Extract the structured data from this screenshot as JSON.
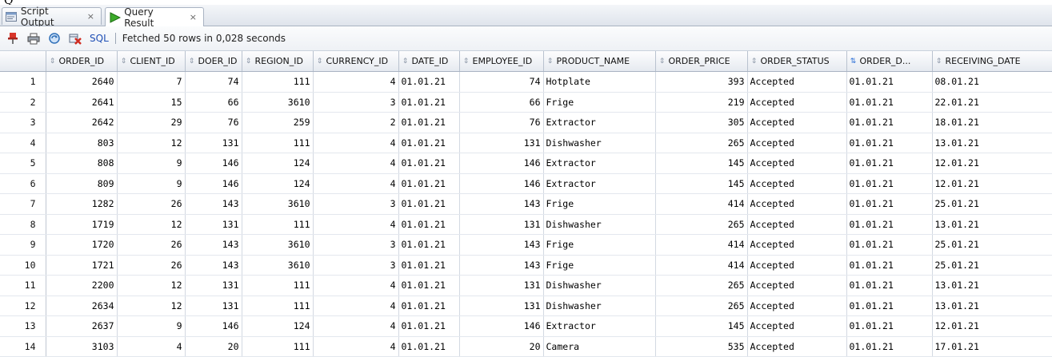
{
  "tabs": [
    {
      "label": "Script Output",
      "close": "×",
      "icon": "script-output-icon"
    },
    {
      "label": "Query Result",
      "close": "×",
      "icon": "run-arrow-icon"
    }
  ],
  "toolbar": {
    "sql_label": "SQL",
    "status": "Fetched 50 rows in 0,028 seconds",
    "icons": [
      "pin-icon",
      "print-icon",
      "refresh-icon",
      "delete-icon"
    ]
  },
  "colors": {
    "accent": "#2b6fd6",
    "link": "#1f4fb5",
    "header_bg": "#e6eaf0"
  },
  "grid": {
    "columns": [
      "ORDER_ID",
      "CLIENT_ID",
      "DOER_ID",
      "REGION_ID",
      "CURRENCY_ID",
      "DATE_ID",
      "EMPLOYEE_ID",
      "PRODUCT_NAME",
      "ORDER_PRICE",
      "ORDER_STATUS",
      "ORDER_D...",
      "RECEIVING_DATE"
    ],
    "rows": [
      [
        "1",
        "2640",
        "7",
        "74",
        "111",
        "4",
        "01.01.21",
        "74",
        "Hotplate",
        "393",
        "Accepted",
        "01.01.21",
        "08.01.21"
      ],
      [
        "2",
        "2641",
        "15",
        "66",
        "3610",
        "3",
        "01.01.21",
        "66",
        "Frige",
        "219",
        "Accepted",
        "01.01.21",
        "22.01.21"
      ],
      [
        "3",
        "2642",
        "29",
        "76",
        "259",
        "2",
        "01.01.21",
        "76",
        "Extractor",
        "305",
        "Accepted",
        "01.01.21",
        "18.01.21"
      ],
      [
        "4",
        "803",
        "12",
        "131",
        "111",
        "4",
        "01.01.21",
        "131",
        "Dishwasher",
        "265",
        "Accepted",
        "01.01.21",
        "13.01.21"
      ],
      [
        "5",
        "808",
        "9",
        "146",
        "124",
        "4",
        "01.01.21",
        "146",
        "Extractor",
        "145",
        "Accepted",
        "01.01.21",
        "12.01.21"
      ],
      [
        "6",
        "809",
        "9",
        "146",
        "124",
        "4",
        "01.01.21",
        "146",
        "Extractor",
        "145",
        "Accepted",
        "01.01.21",
        "12.01.21"
      ],
      [
        "7",
        "1282",
        "26",
        "143",
        "3610",
        "3",
        "01.01.21",
        "143",
        "Frige",
        "414",
        "Accepted",
        "01.01.21",
        "25.01.21"
      ],
      [
        "8",
        "1719",
        "12",
        "131",
        "111",
        "4",
        "01.01.21",
        "131",
        "Dishwasher",
        "265",
        "Accepted",
        "01.01.21",
        "13.01.21"
      ],
      [
        "9",
        "1720",
        "26",
        "143",
        "3610",
        "3",
        "01.01.21",
        "143",
        "Frige",
        "414",
        "Accepted",
        "01.01.21",
        "25.01.21"
      ],
      [
        "10",
        "1721",
        "26",
        "143",
        "3610",
        "3",
        "01.01.21",
        "143",
        "Frige",
        "414",
        "Accepted",
        "01.01.21",
        "25.01.21"
      ],
      [
        "11",
        "2200",
        "12",
        "131",
        "111",
        "4",
        "01.01.21",
        "131",
        "Dishwasher",
        "265",
        "Accepted",
        "01.01.21",
        "13.01.21"
      ],
      [
        "12",
        "2634",
        "12",
        "131",
        "111",
        "4",
        "01.01.21",
        "131",
        "Dishwasher",
        "265",
        "Accepted",
        "01.01.21",
        "13.01.21"
      ],
      [
        "13",
        "2637",
        "9",
        "146",
        "124",
        "4",
        "01.01.21",
        "146",
        "Extractor",
        "145",
        "Accepted",
        "01.01.21",
        "12.01.21"
      ],
      [
        "14",
        "3103",
        "4",
        "20",
        "111",
        "4",
        "01.01.21",
        "20",
        "Camera",
        "535",
        "Accepted",
        "01.01.21",
        "17.01.21"
      ]
    ]
  }
}
